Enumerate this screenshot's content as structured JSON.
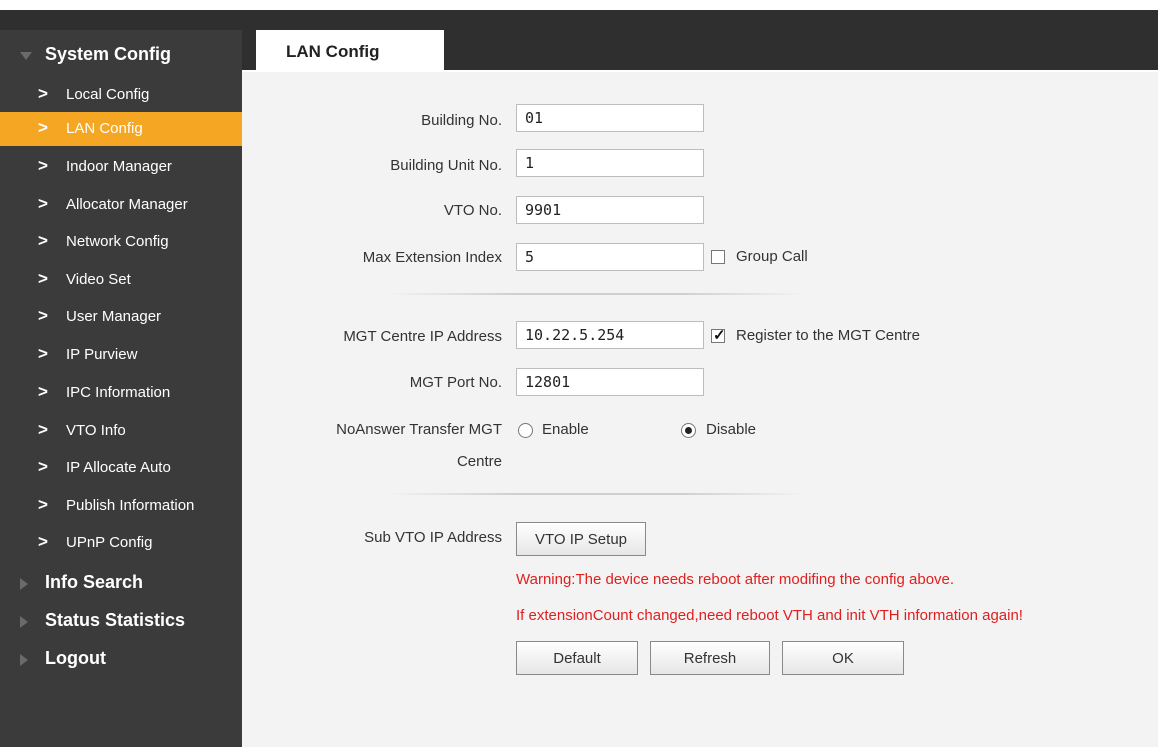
{
  "sidebar": {
    "sections": [
      {
        "label": "System Config",
        "expanded": true
      },
      {
        "label": "Info Search",
        "expanded": false
      },
      {
        "label": "Status Statistics",
        "expanded": false
      },
      {
        "label": "Logout",
        "expanded": false
      }
    ],
    "items": [
      {
        "label": "Local Config"
      },
      {
        "label": "LAN Config",
        "active": true
      },
      {
        "label": "Indoor Manager"
      },
      {
        "label": "Allocator Manager"
      },
      {
        "label": "Network Config"
      },
      {
        "label": "Video Set"
      },
      {
        "label": "User Manager"
      },
      {
        "label": "IP Purview"
      },
      {
        "label": "IPC Information"
      },
      {
        "label": "VTO Info"
      },
      {
        "label": "IP Allocate Auto"
      },
      {
        "label": "Publish Information"
      },
      {
        "label": "UPnP Config"
      }
    ],
    "chevron": ">"
  },
  "tab": {
    "label": "LAN Config"
  },
  "form": {
    "building_no": {
      "label": "Building No.",
      "value": "01"
    },
    "building_unit_no": {
      "label": "Building Unit No.",
      "value": "1"
    },
    "vto_no": {
      "label": "VTO No.",
      "value": "9901"
    },
    "max_extension_index": {
      "label": "Max Extension Index",
      "value": "5"
    },
    "group_call": {
      "label": "Group Call",
      "checked": false
    },
    "mgt_centre_ip": {
      "label": "MGT Centre IP Address",
      "value": "10.22.5.254"
    },
    "register_mgt": {
      "label": "Register to the MGT Centre",
      "checked": true,
      "mark": "✓"
    },
    "mgt_port": {
      "label": "MGT Port No.",
      "value": "12801"
    },
    "noanswer_transfer": {
      "label_line1": "NoAnswer Transfer MGT",
      "label_line2": "Centre",
      "enable_label": "Enable",
      "disable_label": "Disable",
      "selected": "Disable"
    },
    "sub_vto_ip": {
      "label": "Sub VTO IP Address",
      "button": "VTO IP Setup"
    }
  },
  "warnings": {
    "line1": "Warning:The device needs reboot after modifing the config above.",
    "line2": "If extensionCount changed,need reboot VTH and init VTH information again!"
  },
  "buttons": {
    "default": "Default",
    "refresh": "Refresh",
    "ok": "OK"
  },
  "colors": {
    "accent": "#f5a623",
    "warning": "#e02020",
    "sidebar_bg": "#3b3b3b"
  }
}
